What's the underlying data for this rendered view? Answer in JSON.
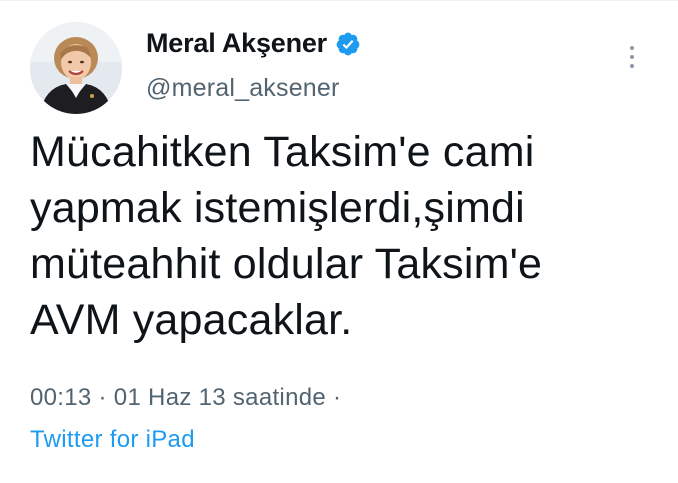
{
  "tweet": {
    "author": {
      "display_name": "Meral Akşener",
      "handle": "@meral_aksener",
      "verified": true
    },
    "text": "Mücahitken Taksim'e cami\nyapmak istemişlerdi,şimdi\nmüteahhit oldular Taksim'e\nAVM yapacaklar.",
    "time": "00:13",
    "separator": "·",
    "date": "01 Haz 13 saatinde",
    "trailing_separator": "·",
    "source": "Twitter for iPad"
  },
  "icons": {
    "verified": "verified-badge-icon",
    "more": "more-options-icon"
  },
  "colors": {
    "text_primary": "#0f1419",
    "text_secondary": "#536471",
    "accent": "#1d9bf0"
  }
}
